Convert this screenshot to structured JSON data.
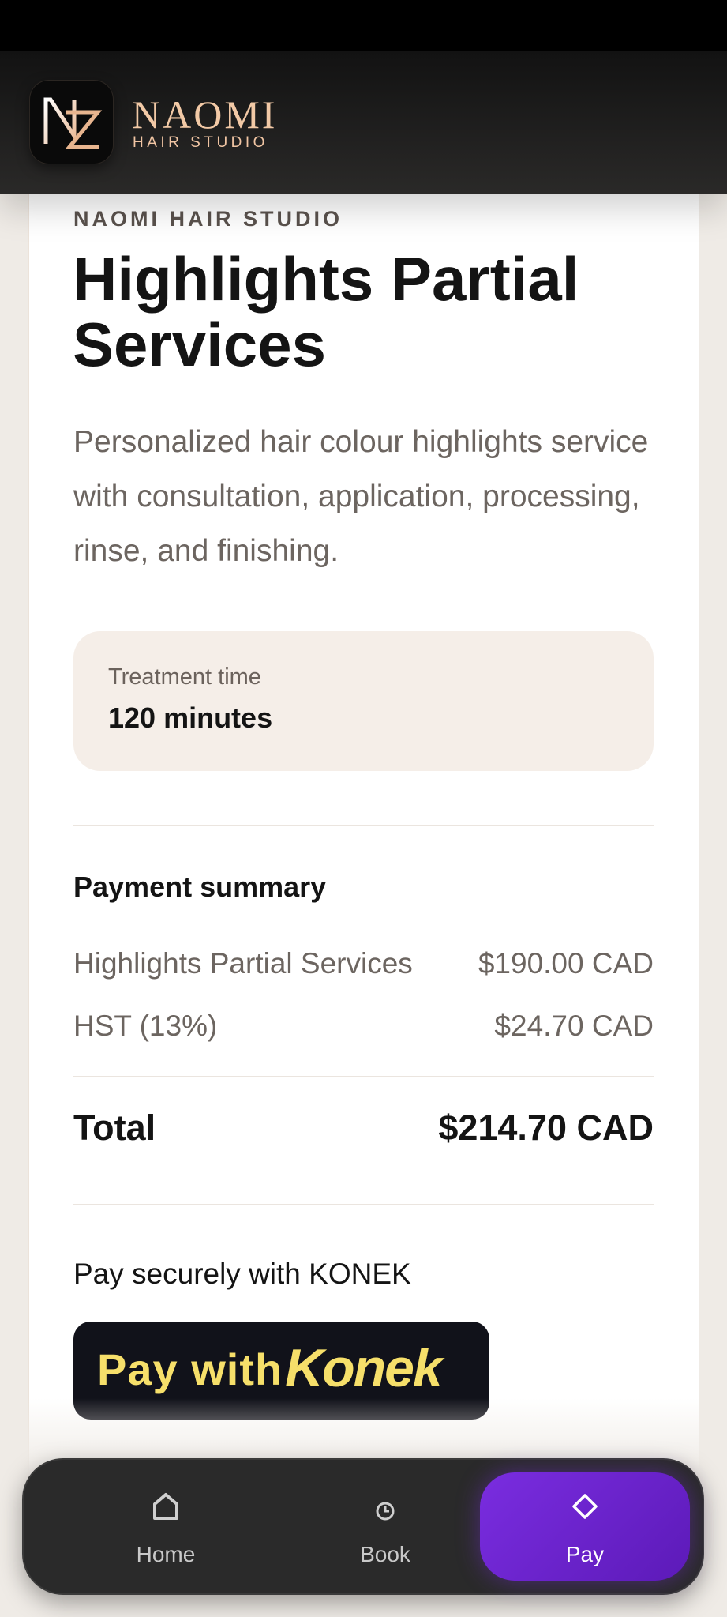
{
  "brand": {
    "name": "NAOMI",
    "subtitle": "HAIR STUDIO"
  },
  "service": {
    "eyebrow": "NAOMI HAIR STUDIO",
    "title": "Highlights Partial Services",
    "description": "Personalized hair colour highlights service with consultation, application, processing, rinse, and finishing."
  },
  "treatment": {
    "label": "Treatment time",
    "value": "120 minutes"
  },
  "payment": {
    "title": "Payment summary",
    "lines": [
      {
        "label": "Highlights Partial Services",
        "amount": "$190.00 CAD"
      },
      {
        "label": "HST (13%)",
        "amount": "$24.70 CAD"
      }
    ],
    "total_label": "Total",
    "total_amount": "$214.70 CAD",
    "secure_text": "Pay securely with KONEK",
    "button_prefix": "Pay with",
    "button_brand": "Konek"
  },
  "nav": {
    "items": [
      {
        "label": "Home",
        "icon": "home-icon"
      },
      {
        "label": "Book",
        "icon": "clock-icon"
      },
      {
        "label": "Pay",
        "icon": "diamond-icon",
        "active": true
      }
    ]
  },
  "colors": {
    "accent": "#7a2de0",
    "brand_gold": "#f2c9a6",
    "konek_yellow": "#f6df6a"
  }
}
